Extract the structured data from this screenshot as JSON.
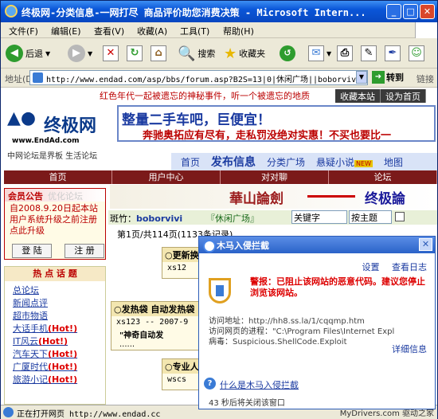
{
  "window": {
    "title": "终极网-分类信息-一网打尽 商品评价助您消费决策 - Microsoft Intern..."
  },
  "menu": [
    "文件(F)",
    "编辑(E)",
    "查看(V)",
    "收藏(A)",
    "工具(T)",
    "帮助(H)"
  ],
  "toolbar": {
    "back": "后退",
    "search": "搜索",
    "favorites": "收藏夹"
  },
  "address": {
    "label": "地址(D)",
    "url": "http://www.endad.com/asp/bbs/forum.asp?B2S=13|0|休闲广场||boborvivi",
    "go": "转到",
    "links": "链接"
  },
  "site": {
    "marquee": "红色年代一起被遗忘的神秘事件，听一个被遗忘的地质",
    "topnav": [
      "收藏本站",
      "设为首页"
    ],
    "logo_cn": "终极网",
    "logo_url": "www.EndAd.com",
    "sub": "中网论坛是界板 生活论坛",
    "ad_line1": "整量二手车吧，巨便宜！",
    "ad_line2": "奔驰奥拓应有尽有，走私罚没绝对实惠！不买也要比一",
    "nav2": [
      "首页",
      "发布信息",
      "分类广场",
      "悬疑小说",
      "地图"
    ],
    "nav2_new": "NEW",
    "redbar": [
      "首页",
      "用户中心",
      "对对聊",
      "论坛"
    ],
    "notice_title": "会员公告",
    "notice_more": "优化论坛",
    "notice_body": "自2008.9.20日起本站用户系统升级之前注册点此升级",
    "login": "登 陆",
    "register": "注 册",
    "hot_title": "热 点 话 题",
    "hot_items": [
      {
        "label": "总论坛",
        "hot": ""
      },
      {
        "label": "新闻点评",
        "hot": ""
      },
      {
        "label": "超市物语",
        "hot": ""
      },
      {
        "label": "大话手机",
        "hot": "(Hot!)"
      },
      {
        "label": "IT风云",
        "hot": "(Hot!)"
      },
      {
        "label": "汽车天下",
        "hot": "(Hot!)"
      },
      {
        "label": "广厦时代",
        "hot": "(Hot!)"
      },
      {
        "label": "旅游小记",
        "hot": "(Hot!)"
      }
    ],
    "banner_left": "華山論劍",
    "banner_right": "终极論",
    "forum_mod_label": "斑竹：",
    "forum_mod": "boborvivi",
    "forum_section": "『休闲广场』",
    "forum_kw": "关键字",
    "forum_sel": "按主题",
    "pages": "第1页/共114页(1133条记录)",
    "card1_title": "○更新换",
    "card1_user": "xs12",
    "card2_title": "○发热袋 自动发热袋",
    "card2_user": "xs123 -- 2007-9",
    "card2_text": "\"神奇自动发",
    "card2_more": "......",
    "card3_title": "○专业人",
    "card3_user": "wscs"
  },
  "popup": {
    "title": "木马入侵拦截",
    "settings": "设置",
    "log": "查看日志",
    "warning": "警报：已阻止该网站的恶意代码。建议您停止浏览该网站。",
    "addr_label": "访问地址：",
    "addr": "http://hh8.ss.la/1/cqqmp.htm",
    "proc_label": "访问网页的进程：",
    "proc": "\"C:\\Program Files\\Internet Expl",
    "virus_label": "病毒：",
    "virus": "Suspicious.ShellCode.Exploit",
    "detail": "详细信息",
    "what": "什么是木马入侵拦截",
    "countdown": "43 秒后将关闭该窗口"
  },
  "status": {
    "text": "正在打开网页 http://www.endad.cc",
    "watermark": "MyDrivers.com 驱动之家"
  }
}
